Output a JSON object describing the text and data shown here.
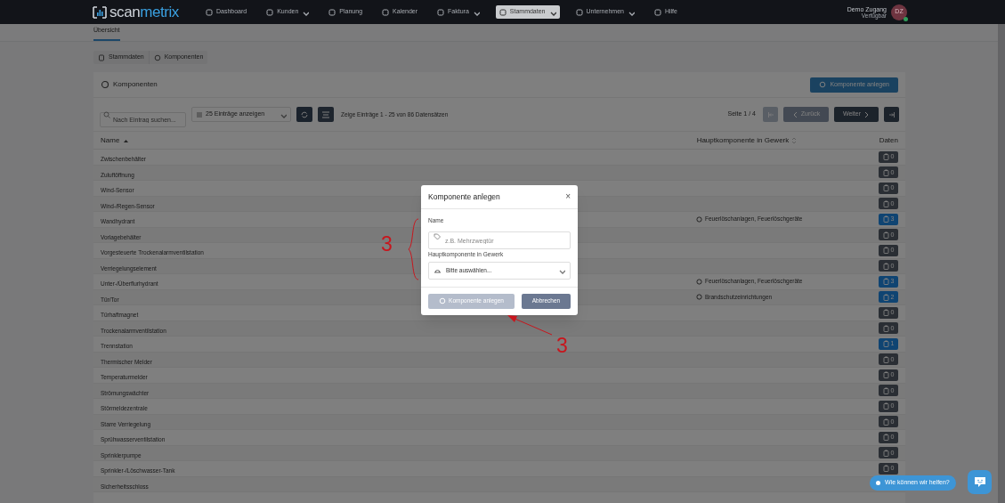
{
  "nav": {
    "logo_a": "scan",
    "logo_b": "metrix",
    "items": [
      {
        "label": "Dashboard",
        "dropdown": false,
        "selected": false
      },
      {
        "label": "Kunden",
        "dropdown": true,
        "selected": false
      },
      {
        "label": "Planung",
        "dropdown": false,
        "selected": false
      },
      {
        "label": "Kalender",
        "dropdown": false,
        "selected": false
      },
      {
        "label": "Faktura",
        "dropdown": true,
        "selected": false
      },
      {
        "label": "Stammdaten",
        "dropdown": true,
        "selected": true
      },
      {
        "label": "Unternehmen",
        "dropdown": true,
        "selected": false
      },
      {
        "label": "Hilfe",
        "dropdown": false,
        "selected": false
      }
    ],
    "user": {
      "name": "Demo Zugang",
      "status": "Verfügbar",
      "initials": "DZ"
    }
  },
  "subnav": {
    "tabs": [
      {
        "label": "Übersicht",
        "selected": true
      }
    ]
  },
  "breadcrumb": [
    "Stammdaten",
    "Komponenten"
  ],
  "card": {
    "title": "Komponenten",
    "create_button": "Komponente anlegen",
    "search": {
      "placeholder": "Nach Eintrag suchen..."
    },
    "page_size": "25 Einträge anzeigen",
    "summary": "Zeige Einträge 1 - 25 von 86 Datensätzen",
    "page": "Seite 1 / 4",
    "prev": "Zurück",
    "next": "Weiter",
    "columns": [
      "Name",
      "Hauptkomponente in Gewerk",
      "Daten"
    ],
    "rows": [
      {
        "name": "Zwischenbehälter",
        "count": "0",
        "highlighted": false
      },
      {
        "name": "Zuluftöffnung",
        "count": "0",
        "highlighted": false
      },
      {
        "name": "Wind-Sensor",
        "count": "0",
        "highlighted": false
      },
      {
        "name": "Wind-/Regen-Sensor",
        "count": "0",
        "highlighted": false
      },
      {
        "name": "Wandhydrant",
        "gewerk": "Feuerlöschanlagen, Feuerlöschgeräte",
        "count": "3",
        "highlighted": true
      },
      {
        "name": "Vorlagebehälter",
        "count": "0",
        "highlighted": false
      },
      {
        "name": "Vorgesteuerte Trockenalarmventilstation",
        "count": "0",
        "highlighted": false
      },
      {
        "name": "Verriegelungselement",
        "count": "0",
        "highlighted": false
      },
      {
        "name": "Unter-/Überflurhydrant",
        "gewerk": "Feuerlöschanlagen, Feuerlöschgeräte",
        "count": "3",
        "highlighted": true
      },
      {
        "name": "Tür/Tor",
        "gewerk": "Brandschutzeinrichtungen",
        "count": "2",
        "highlighted": true
      },
      {
        "name": "Türhaftmagnet",
        "count": "0",
        "highlighted": false
      },
      {
        "name": "Trockenalarmventilstation",
        "count": "0",
        "highlighted": false
      },
      {
        "name": "Trennstation",
        "count": "1",
        "highlighted": true
      },
      {
        "name": "Thermischer Melder",
        "count": "0",
        "highlighted": false
      },
      {
        "name": "Temperaturmelder",
        "count": "0",
        "highlighted": false
      },
      {
        "name": "Strömungswächter",
        "count": "0",
        "highlighted": false
      },
      {
        "name": "Störmeldezentrale",
        "count": "0",
        "highlighted": false
      },
      {
        "name": "Starre Verriegelung",
        "count": "0",
        "highlighted": false
      },
      {
        "name": "Sprühwasserventilstation",
        "count": "0",
        "highlighted": false
      },
      {
        "name": "Sprinklerpumpe",
        "count": "0",
        "highlighted": false
      },
      {
        "name": "Sprinkler-/Löschwasser-Tank",
        "count": "0",
        "highlighted": false
      },
      {
        "name": "Sicherheitsschloss"
      }
    ]
  },
  "modal": {
    "title": "Komponente anlegen",
    "close": "×",
    "fields": [
      {
        "kind": "text",
        "label": "Name",
        "placeholder": "z.B. Mehrzwegtür"
      },
      {
        "kind": "select",
        "label": "Hauptkomponente in Gewerk",
        "value": "Bitte auswählen..."
      }
    ],
    "buttons": [
      {
        "label": "Komponente anlegen",
        "disabled": true
      },
      {
        "label": "Abbrechen",
        "disabled": false
      }
    ]
  },
  "annotations": [
    {
      "kind": "brace",
      "label": "3"
    },
    {
      "kind": "arrow",
      "label": "3"
    }
  ],
  "chat": {
    "label": "Wie können wir helfen?"
  }
}
